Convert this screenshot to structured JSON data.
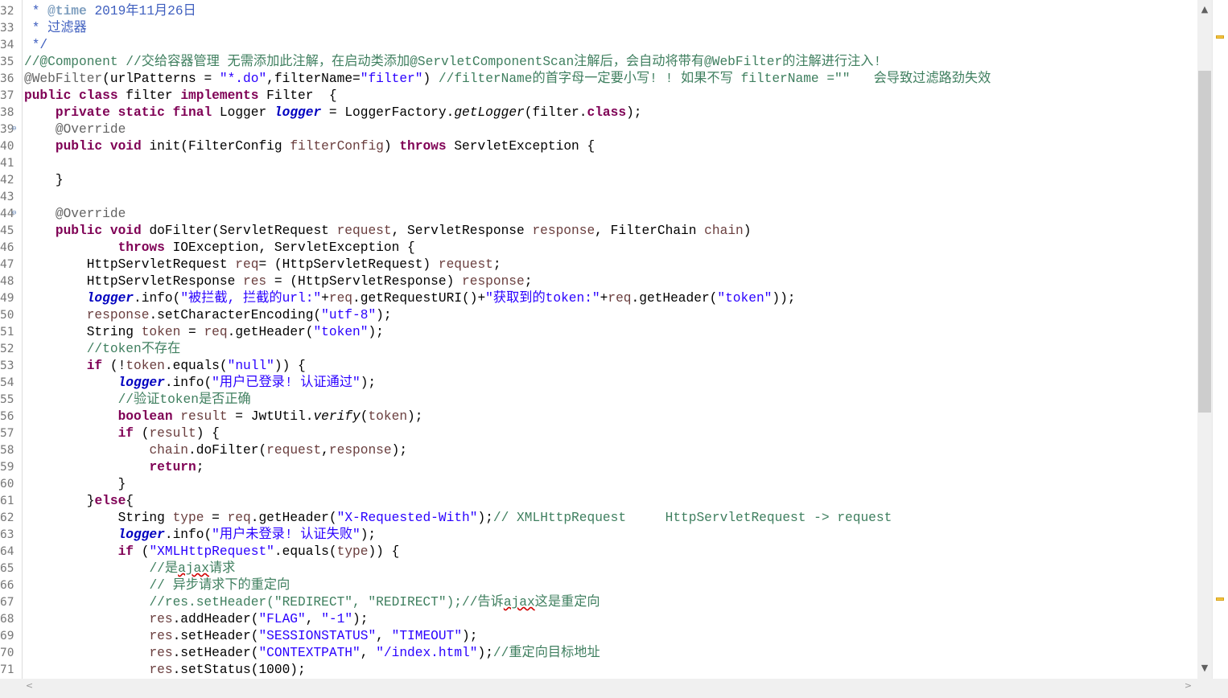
{
  "editor": {
    "lines": [
      {
        "n": "32",
        "segs": [
          {
            "t": " * ",
            "c": "jd"
          },
          {
            "t": "@time",
            "c": "jt"
          },
          {
            "t": " 2019年11月26日",
            "c": "jd"
          }
        ]
      },
      {
        "n": "33",
        "segs": [
          {
            "t": " * 过滤器",
            "c": "jd"
          }
        ]
      },
      {
        "n": "34",
        "segs": [
          {
            "t": " */",
            "c": "jd"
          }
        ]
      },
      {
        "n": "35",
        "segs": [
          {
            "t": "//@Component //交给容器管理 无需添加此注解，在启动类添加@ServletComponentScan注解后，会自动将带有@WebFilter的注解进行注入!",
            "c": "cm"
          }
        ]
      },
      {
        "n": "36",
        "segs": [
          {
            "t": "@WebFilter",
            "c": "an"
          },
          {
            "t": "(urlPatterns = "
          },
          {
            "t": "\"*.do\"",
            "c": "st"
          },
          {
            "t": ",filterName="
          },
          {
            "t": "\"filter\"",
            "c": "st"
          },
          {
            "t": ") "
          },
          {
            "t": "//filterName的首字母一定要小写! ! 如果不写 filterName =\"\"   会导致过滤路劲失效",
            "c": "cm"
          }
        ]
      },
      {
        "n": "37",
        "segs": [
          {
            "t": "public",
            "c": "kw"
          },
          {
            "t": " "
          },
          {
            "t": "class",
            "c": "kw"
          },
          {
            "t": " filter "
          },
          {
            "t": "implements",
            "c": "kw"
          },
          {
            "t": " Filter  {"
          }
        ]
      },
      {
        "n": "38",
        "segs": [
          {
            "t": "    "
          },
          {
            "t": "private",
            "c": "kw"
          },
          {
            "t": " "
          },
          {
            "t": "static",
            "c": "kw"
          },
          {
            "t": " "
          },
          {
            "t": "final",
            "c": "kw"
          },
          {
            "t": " Logger "
          },
          {
            "t": "logger",
            "c": "sf"
          },
          {
            "t": " = LoggerFactory."
          },
          {
            "t": "getLogger",
            "c": "it"
          },
          {
            "t": "(filter."
          },
          {
            "t": "class",
            "c": "kw"
          },
          {
            "t": ");"
          }
        ]
      },
      {
        "n": "39",
        "fold": true,
        "segs": [
          {
            "t": "    "
          },
          {
            "t": "@Override",
            "c": "an"
          }
        ]
      },
      {
        "n": "40",
        "segs": [
          {
            "t": "    "
          },
          {
            "t": "public",
            "c": "kw"
          },
          {
            "t": " "
          },
          {
            "t": "void",
            "c": "kw"
          },
          {
            "t": " init(FilterConfig "
          },
          {
            "t": "filterConfig",
            "c": "pr"
          },
          {
            "t": ") "
          },
          {
            "t": "throws",
            "c": "kw"
          },
          {
            "t": " ServletException {"
          }
        ]
      },
      {
        "n": "41",
        "segs": []
      },
      {
        "n": "42",
        "segs": [
          {
            "t": "    }"
          }
        ]
      },
      {
        "n": "43",
        "segs": []
      },
      {
        "n": "44",
        "fold": true,
        "segs": [
          {
            "t": "    "
          },
          {
            "t": "@Override",
            "c": "an"
          }
        ]
      },
      {
        "n": "45",
        "segs": [
          {
            "t": "    "
          },
          {
            "t": "public",
            "c": "kw"
          },
          {
            "t": " "
          },
          {
            "t": "void",
            "c": "kw"
          },
          {
            "t": " doFilter(ServletRequest "
          },
          {
            "t": "request",
            "c": "pr"
          },
          {
            "t": ", ServletResponse "
          },
          {
            "t": "response",
            "c": "pr"
          },
          {
            "t": ", FilterChain "
          },
          {
            "t": "chain",
            "c": "pr"
          },
          {
            "t": ")"
          }
        ]
      },
      {
        "n": "46",
        "segs": [
          {
            "t": "            "
          },
          {
            "t": "throws",
            "c": "kw"
          },
          {
            "t": " IOException, ServletException {"
          }
        ]
      },
      {
        "n": "47",
        "segs": [
          {
            "t": "        HttpServletRequest "
          },
          {
            "t": "req",
            "c": "pr"
          },
          {
            "t": "= (HttpServletRequest) "
          },
          {
            "t": "request",
            "c": "pr"
          },
          {
            "t": ";"
          }
        ]
      },
      {
        "n": "48",
        "segs": [
          {
            "t": "        HttpServletResponse "
          },
          {
            "t": "res",
            "c": "pr"
          },
          {
            "t": " = (HttpServletResponse) "
          },
          {
            "t": "response",
            "c": "pr"
          },
          {
            "t": ";"
          }
        ]
      },
      {
        "n": "49",
        "segs": [
          {
            "t": "        "
          },
          {
            "t": "logger",
            "c": "sf"
          },
          {
            "t": ".info("
          },
          {
            "t": "\"被拦截, 拦截的url:\"",
            "c": "st"
          },
          {
            "t": "+"
          },
          {
            "t": "req",
            "c": "pr"
          },
          {
            "t": ".getRequestURI()+"
          },
          {
            "t": "\"获取到的token:\"",
            "c": "st"
          },
          {
            "t": "+"
          },
          {
            "t": "req",
            "c": "pr"
          },
          {
            "t": ".getHeader("
          },
          {
            "t": "\"token\"",
            "c": "st"
          },
          {
            "t": "));"
          }
        ]
      },
      {
        "n": "50",
        "segs": [
          {
            "t": "        "
          },
          {
            "t": "response",
            "c": "pr"
          },
          {
            "t": ".setCharacterEncoding("
          },
          {
            "t": "\"utf-8\"",
            "c": "st"
          },
          {
            "t": ");"
          }
        ]
      },
      {
        "n": "51",
        "segs": [
          {
            "t": "        String "
          },
          {
            "t": "token",
            "c": "pr"
          },
          {
            "t": " = "
          },
          {
            "t": "req",
            "c": "pr"
          },
          {
            "t": ".getHeader("
          },
          {
            "t": "\"token\"",
            "c": "st"
          },
          {
            "t": ");"
          }
        ]
      },
      {
        "n": "52",
        "segs": [
          {
            "t": "        "
          },
          {
            "t": "//token不存在",
            "c": "cm"
          }
        ]
      },
      {
        "n": "53",
        "segs": [
          {
            "t": "        "
          },
          {
            "t": "if",
            "c": "kw"
          },
          {
            "t": " (!"
          },
          {
            "t": "token",
            "c": "pr"
          },
          {
            "t": ".equals("
          },
          {
            "t": "\"null\"",
            "c": "st"
          },
          {
            "t": ")) {"
          }
        ]
      },
      {
        "n": "54",
        "segs": [
          {
            "t": "            "
          },
          {
            "t": "logger",
            "c": "sf"
          },
          {
            "t": ".info("
          },
          {
            "t": "\"用户已登录! 认证通过\"",
            "c": "st"
          },
          {
            "t": ");"
          }
        ]
      },
      {
        "n": "55",
        "segs": [
          {
            "t": "            "
          },
          {
            "t": "//验证token是否正确",
            "c": "cm"
          }
        ]
      },
      {
        "n": "56",
        "segs": [
          {
            "t": "            "
          },
          {
            "t": "boolean",
            "c": "kw"
          },
          {
            "t": " "
          },
          {
            "t": "result",
            "c": "pr"
          },
          {
            "t": " = JwtUtil."
          },
          {
            "t": "verify",
            "c": "it"
          },
          {
            "t": "("
          },
          {
            "t": "token",
            "c": "pr"
          },
          {
            "t": ");"
          }
        ]
      },
      {
        "n": "57",
        "segs": [
          {
            "t": "            "
          },
          {
            "t": "if",
            "c": "kw"
          },
          {
            "t": " ("
          },
          {
            "t": "result",
            "c": "pr"
          },
          {
            "t": ") {"
          }
        ]
      },
      {
        "n": "58",
        "segs": [
          {
            "t": "                "
          },
          {
            "t": "chain",
            "c": "pr"
          },
          {
            "t": ".doFilter("
          },
          {
            "t": "request",
            "c": "pr"
          },
          {
            "t": ","
          },
          {
            "t": "response",
            "c": "pr"
          },
          {
            "t": ");"
          }
        ]
      },
      {
        "n": "59",
        "segs": [
          {
            "t": "                "
          },
          {
            "t": "return",
            "c": "kw"
          },
          {
            "t": ";"
          }
        ]
      },
      {
        "n": "60",
        "segs": [
          {
            "t": "            }"
          }
        ]
      },
      {
        "n": "61",
        "segs": [
          {
            "t": "        }"
          },
          {
            "t": "else",
            "c": "kw"
          },
          {
            "t": "{"
          }
        ]
      },
      {
        "n": "62",
        "segs": [
          {
            "t": "            String "
          },
          {
            "t": "type",
            "c": "pr"
          },
          {
            "t": " = "
          },
          {
            "t": "req",
            "c": "pr"
          },
          {
            "t": ".getHeader("
          },
          {
            "t": "\"X-Requested-With\"",
            "c": "st"
          },
          {
            "t": ");"
          },
          {
            "t": "// XMLHttpRequest     HttpServletRequest -> request",
            "c": "cm"
          }
        ]
      },
      {
        "n": "63",
        "segs": [
          {
            "t": "            "
          },
          {
            "t": "logger",
            "c": "sf"
          },
          {
            "t": ".info("
          },
          {
            "t": "\"用户未登录! 认证失败\"",
            "c": "st"
          },
          {
            "t": ");"
          }
        ]
      },
      {
        "n": "64",
        "segs": [
          {
            "t": "            "
          },
          {
            "t": "if",
            "c": "kw"
          },
          {
            "t": " ("
          },
          {
            "t": "\"XMLHttpRequest\"",
            "c": "st"
          },
          {
            "t": ".equals("
          },
          {
            "t": "type",
            "c": "pr"
          },
          {
            "t": ")) {"
          }
        ]
      },
      {
        "n": "65",
        "segs": [
          {
            "t": "                "
          },
          {
            "t": "//是",
            "c": "cm"
          },
          {
            "t": "ajax",
            "c": "cm ul"
          },
          {
            "t": "请求",
            "c": "cm"
          }
        ]
      },
      {
        "n": "66",
        "segs": [
          {
            "t": "                "
          },
          {
            "t": "// 异步请求下的重定向",
            "c": "cm"
          }
        ]
      },
      {
        "n": "67",
        "segs": [
          {
            "t": "                "
          },
          {
            "t": "//res.setHeader(\"REDIRECT\", \"REDIRECT\");//告诉",
            "c": "cm"
          },
          {
            "t": "ajax",
            "c": "cm ul"
          },
          {
            "t": "这是重定向",
            "c": "cm"
          }
        ]
      },
      {
        "n": "68",
        "segs": [
          {
            "t": "                "
          },
          {
            "t": "res",
            "c": "pr"
          },
          {
            "t": ".addHeader("
          },
          {
            "t": "\"FLAG\"",
            "c": "st"
          },
          {
            "t": ", "
          },
          {
            "t": "\"-1\"",
            "c": "st"
          },
          {
            "t": ");"
          }
        ]
      },
      {
        "n": "69",
        "segs": [
          {
            "t": "                "
          },
          {
            "t": "res",
            "c": "pr"
          },
          {
            "t": ".setHeader("
          },
          {
            "t": "\"SESSIONSTATUS\"",
            "c": "st"
          },
          {
            "t": ", "
          },
          {
            "t": "\"TIMEOUT\"",
            "c": "st"
          },
          {
            "t": ");"
          }
        ]
      },
      {
        "n": "70",
        "segs": [
          {
            "t": "                "
          },
          {
            "t": "res",
            "c": "pr"
          },
          {
            "t": ".setHeader("
          },
          {
            "t": "\"CONTEXTPATH\"",
            "c": "st"
          },
          {
            "t": ", "
          },
          {
            "t": "\"/index.html\"",
            "c": "st"
          },
          {
            "t": ");"
          },
          {
            "t": "//重定向目标地址",
            "c": "cm"
          }
        ]
      },
      {
        "n": "71",
        "segs": [
          {
            "t": "                "
          },
          {
            "t": "res",
            "c": "pr"
          },
          {
            "t": ".setStatus(1000);"
          }
        ]
      }
    ]
  },
  "scrollbar": {
    "up_icon": "▲",
    "down_icon": "▼",
    "left_icon": "<",
    "right_icon": ">"
  },
  "overview_marks": 2
}
